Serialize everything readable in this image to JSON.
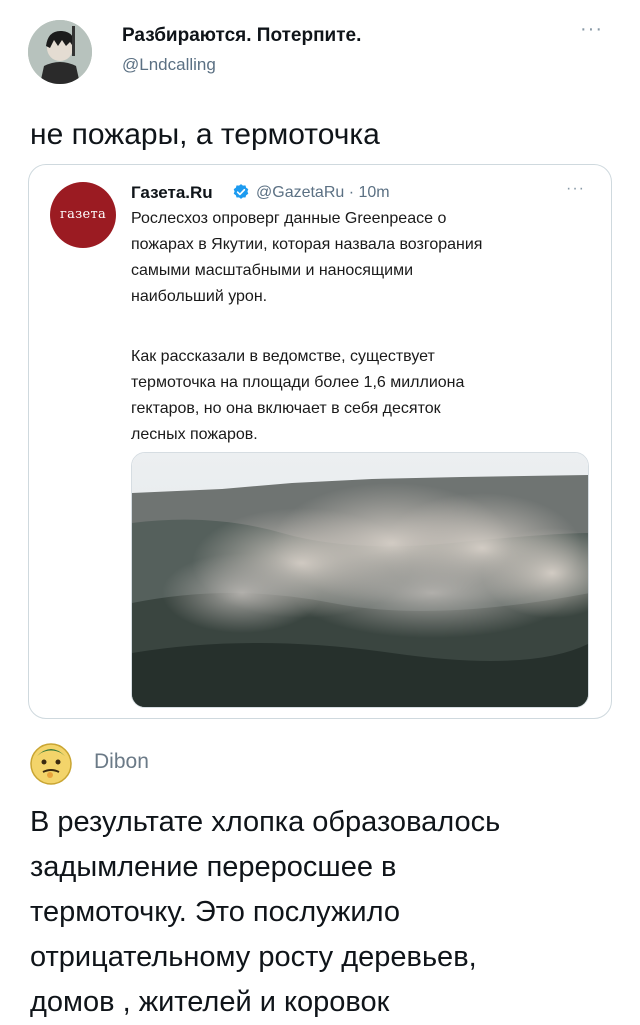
{
  "tweet": {
    "author_name": "Разбираются. Потерпите.",
    "author_handle": "@Lndcalling",
    "more_label": "···",
    "text": "не пожары, а термоточка"
  },
  "quoted": {
    "avatar_text": "газета",
    "name": "Газета.Ru",
    "handle_time": "@GazetaRu · 10m",
    "more_label": "···",
    "paragraph1": [
      "Рослесхоз опроверг данные Greenpeace о",
      "пожарах в Якутии, которая назвала возгорания",
      "самыми масштабными и наносящими",
      "наибольший урон."
    ],
    "paragraph2": [
      "Как рассказали в ведомстве, существует",
      "термоточка на площади более 1,6 миллиона",
      "гектаров, но она включает в себя десяток",
      "лесных пожаров."
    ],
    "photo_icon": "forest-fire-smoke-photo"
  },
  "reply": {
    "name": "Dibon",
    "lines": [
      "В  результате хлопка образовалось",
      "задымление переросшее в",
      "термоточку. Это послужило",
      "отрицательному росту деревьев,",
      "домов , жителей и коровок"
    ]
  },
  "colors": {
    "brand_red": "#9b1b22",
    "verified_blue": "#1d9bf0",
    "muted": "#5b7083"
  }
}
